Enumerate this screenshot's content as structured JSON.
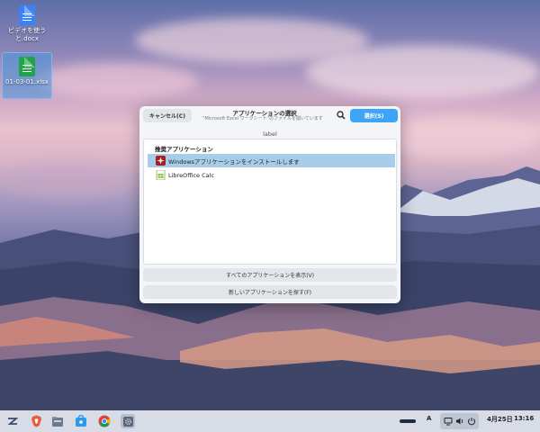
{
  "desktop": {
    "icons": [
      {
        "label": "ビデオを使うと.docx"
      },
      {
        "label": "01-03-01.xlsx"
      }
    ]
  },
  "dialog": {
    "cancel_label": "キャンセル(C)",
    "title": "アプリケーションの選択",
    "subtitle": "\"Microsoft Excel ワークシート\"のファイルを開いています",
    "select_label": "選択(S)",
    "label_text": "label",
    "section_title": "推奨アプリケーション",
    "apps": [
      {
        "name": "Windowsアプリケーションをインストールします",
        "icon": "wine-icon",
        "selected": true
      },
      {
        "name": "LibreOffice Calc",
        "icon": "libreoffice-calc-icon",
        "selected": false
      }
    ],
    "show_all_label": "すべてのアプリケーションを表示(V)",
    "find_new_label": "新しいアプリケーションを探す(F)"
  },
  "taskbar": {
    "launchers": [
      "zorin-menu-icon",
      "brave-icon",
      "files-icon",
      "software-store-icon",
      "chrome-icon",
      "settings-icon"
    ],
    "input_method": "A",
    "date": "4月25日",
    "time": "13:16"
  }
}
